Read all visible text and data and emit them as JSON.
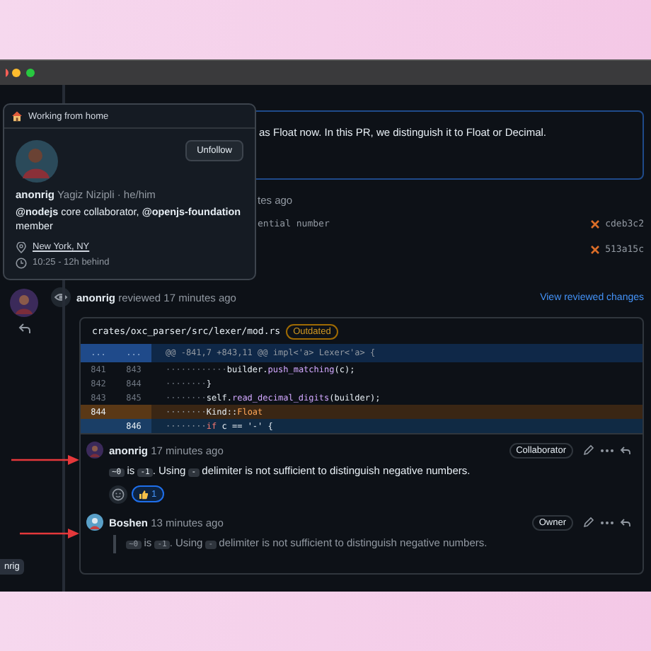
{
  "popover": {
    "status": "Working from home",
    "button": "Unfollow",
    "login": "anonrig",
    "name": "Yagiz Nizipli · he/him",
    "bio": "**@nodejs** core collaborator, **@openjs-foundation** member",
    "location": "New York, NY",
    "time": "10:25 - 12h behind"
  },
  "timeline": {
    "description": "as Float now. In this PR, we distinguish it to Float or Decimal.",
    "time_fragment": "tes ago",
    "commits": [
      {
        "message": "ential number",
        "sha": "cdeb3c2",
        "failed": true
      },
      {
        "sha": "513a15c",
        "failed": true
      }
    ]
  },
  "review": {
    "author": "anonrig",
    "action": "reviewed 17 minutes ago",
    "link": "View reviewed changes",
    "file": "crates/oxc_parser/src/lexer/mod.rs",
    "badge": "Outdated",
    "diff": [
      {
        "kind": "hunk",
        "old": "...",
        "new": "...",
        "code": [
          {
            "t": "@@ -841,7 +843,11 @@ impl<'a> Lexer<'a> {"
          }
        ]
      },
      {
        "kind": "context",
        "old": "841",
        "new": "843",
        "indent": "············",
        "code": [
          {
            "t": "builder."
          },
          {
            "t": "push_matching",
            "kind": "fn"
          },
          {
            "t": "(c);"
          }
        ]
      },
      {
        "kind": "context",
        "old": "842",
        "new": "844",
        "indent": "········",
        "code": [
          {
            "t": "}"
          }
        ]
      },
      {
        "kind": "context",
        "old": "843",
        "new": "845",
        "indent": "········",
        "code": [
          {
            "t": "self."
          },
          {
            "t": "read_decimal_digits",
            "kind": "fn"
          },
          {
            "t": "(builder);"
          }
        ]
      },
      {
        "kind": "deleted",
        "old": "844",
        "indent": "········",
        "code": [
          {
            "t": "Kind::"
          },
          {
            "t": "Float",
            "kind": "type"
          }
        ]
      },
      {
        "kind": "added",
        "new": "846",
        "indent": "········",
        "code": [
          {
            "t": "if",
            "kind": "keyword"
          },
          {
            "t": " c == '-' {"
          }
        ]
      }
    ],
    "comments": [
      {
        "author": "anonrig",
        "time": "17 minutes ago",
        "role": "Collaborator",
        "quoted": false,
        "body": [
          {
            "code": "~0"
          },
          {
            "text": " is "
          },
          {
            "code": "-1"
          },
          {
            "text": ". Using "
          },
          {
            "code": "-"
          },
          {
            "text": " delimiter is not sufficient to distinguish negative numbers."
          }
        ],
        "reactions": [
          {
            "count": "1",
            "selected": true
          }
        ]
      },
      {
        "author": "Boshen",
        "time": "13 minutes ago",
        "role": "Owner",
        "quoted": true,
        "body": [
          {
            "code": "~0"
          },
          {
            "text": " is "
          },
          {
            "code": "-1"
          },
          {
            "text": ". Using "
          },
          {
            "code": "-"
          },
          {
            "text": " delimiter is not sufficient to distinguish negative numbers."
          }
        ]
      }
    ]
  },
  "tooltip": "nrig"
}
